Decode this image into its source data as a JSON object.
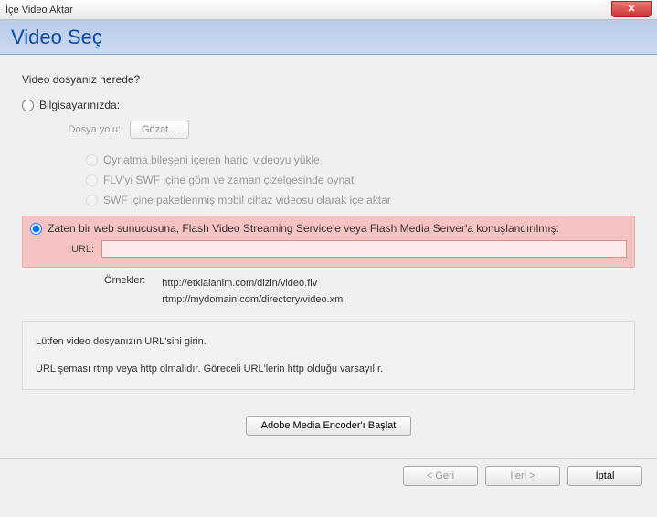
{
  "window": {
    "title": "İçe Video Aktar"
  },
  "header": {
    "title": "Video Seç"
  },
  "question": "Video dosyanız nerede?",
  "options": {
    "onComputer": {
      "label": "Bilgisayarınızda:",
      "filePathLabel": "Dosya yolu:",
      "browse": "Gözat..."
    },
    "sub": {
      "a": "Oynatma bileşeni içeren harici videoyu yükle",
      "b": "FLV'yi SWF içine göm ve zaman çizelgesinde oynat",
      "c": "SWF içine paketlenmiş mobil cihaz videosu olarak içe aktar"
    },
    "deployed": {
      "label": "Zaten bir web sunucusuna, Flash Video Streaming Service'e veya Flash Media Server'a konuşlandırılmış:",
      "urlLabel": "URL:",
      "urlValue": ""
    }
  },
  "examples": {
    "label": "Örnekler:",
    "line1": "http://etkialanim.com/dizin/video.flv",
    "line2": "rtmp://mydomain.com/directory/video.xml"
  },
  "info": {
    "line1": "Lütfen video dosyanızın URL'sini girin.",
    "line2": "URL şeması rtmp veya http olmalıdır.  Göreceli URL'lerin http olduğu varsayılır."
  },
  "buttons": {
    "encoder": "Adobe Media Encoder'ı Başlat",
    "back": "< Geri",
    "next": "İleri >",
    "cancel": "İptal"
  }
}
